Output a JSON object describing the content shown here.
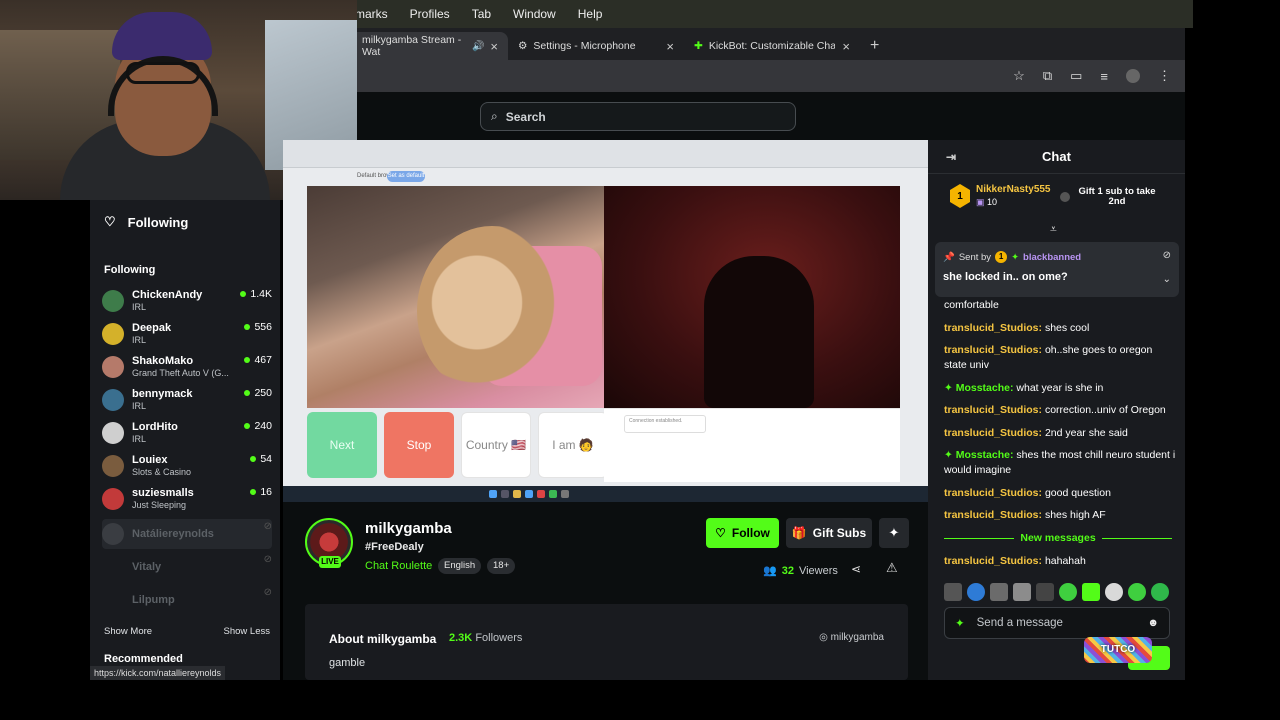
{
  "menubar": {
    "items": [
      "marks",
      "Profiles",
      "Tab",
      "Window",
      "Help"
    ]
  },
  "tabs": [
    {
      "title": "milkygamba Stream - Wat",
      "active": true
    },
    {
      "title": "Settings - Microphone",
      "active": false
    },
    {
      "title": "KickBot: Customizable Chat B",
      "active": false
    }
  ],
  "search": {
    "placeholder": "Search"
  },
  "sidebar": {
    "header": "Following",
    "section_label": "Following",
    "channels": [
      {
        "name": "ChickenAndy",
        "category": "IRL",
        "viewers": "1.4K",
        "live": true
      },
      {
        "name": "Deepak",
        "category": "IRL",
        "viewers": "556",
        "live": true
      },
      {
        "name": "ShakoMako",
        "category": "Grand Theft Auto V (G...",
        "viewers": "467",
        "live": true
      },
      {
        "name": "bennymack",
        "category": "IRL",
        "viewers": "250",
        "live": true
      },
      {
        "name": "LordHito",
        "category": "IRL",
        "viewers": "240",
        "live": true
      },
      {
        "name": "Louiex",
        "category": "Slots & Casino",
        "viewers": "54",
        "live": true
      },
      {
        "name": "suziesmalls",
        "category": "Just Sleeping",
        "viewers": "16",
        "live": true
      },
      {
        "name": "Natáliereynolds",
        "category": "",
        "viewers": "",
        "live": false
      },
      {
        "name": "Vitaly",
        "category": "",
        "viewers": "",
        "live": false
      },
      {
        "name": "Lilpump",
        "category": "",
        "viewers": "",
        "live": false
      }
    ],
    "show_more": "Show More",
    "show_less": "Show Less",
    "recommended": "Recommended",
    "status_url": "https://kick.com/natalliereynolds"
  },
  "video": {
    "buttons": {
      "next": "Next",
      "stop": "Stop",
      "country": "Country 🇺🇸",
      "iam": "I am 🧑"
    },
    "browser_text": "Default browser",
    "set_default": "Set as default",
    "connection": "Connection established."
  },
  "stream": {
    "username": "milkygamba",
    "title": "#FreeDealy",
    "category": "Chat Roulette",
    "tags": [
      "English",
      "18+"
    ],
    "live_badge": "LIVE",
    "follow_label": "Follow",
    "gift_label": "Gift Subs",
    "viewers_count": "32",
    "viewers_label": "Viewers",
    "about_title": "About milkygamba",
    "followers_count": "2.3K",
    "followers_label": "Followers",
    "instagram": "milkygamba",
    "bio": "gamble"
  },
  "chat": {
    "title": "Chat",
    "top_gifter": {
      "rank": "1",
      "name": "NikkerNasty555",
      "count": "10"
    },
    "gift_cta": "Gift 1 sub to take 2nd",
    "pinned": {
      "sent_by_label": "Sent by",
      "badge": "1",
      "user": "blackbanned",
      "message": "she locked in.. on ome?"
    },
    "messages": [
      {
        "user": "",
        "text": "comfortable"
      },
      {
        "user": "translucid_Studios",
        "text": "shes cool"
      },
      {
        "user": "translucid_Studios",
        "text": "oh..she goes to oregon state univ"
      },
      {
        "user": "Mosstache",
        "text": "what year is she in",
        "green": true
      },
      {
        "user": "translucid_Studios",
        "text": "correction..univ of Oregon"
      },
      {
        "user": "translucid_Studios",
        "text": "2nd year she said"
      },
      {
        "user": "Mosstache",
        "text": "shes the most chill neuro student i would imagine",
        "green": true
      },
      {
        "user": "translucid_Studios",
        "text": "good question"
      },
      {
        "user": "translucid_Studios",
        "text": "shes high AF"
      }
    ],
    "new_messages_label": "New messages",
    "last_message": {
      "user": "translucid_Studios",
      "text": "hahahah"
    },
    "input_placeholder": "Send a message",
    "overlay_text": "TUTCO"
  },
  "colors": {
    "accent": "#53fc18",
    "username": "#f5c542",
    "bg": "#0b0e0f",
    "panel": "#191b1f"
  }
}
